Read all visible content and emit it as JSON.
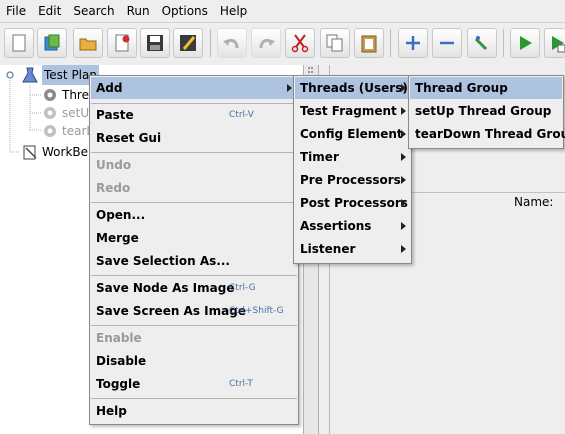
{
  "menubar": {
    "items": [
      "File",
      "Edit",
      "Search",
      "Run",
      "Options",
      "Help"
    ]
  },
  "toolbar": {
    "buttons": [
      "new-icon",
      "templates-icon",
      "open-icon",
      "close-icon",
      "save-icon",
      "save-as-icon",
      "undo-icon",
      "redo-icon",
      "cut-icon",
      "copy-icon",
      "paste-icon",
      "expand-icon",
      "collapse-icon",
      "toggle-icon",
      "start-icon",
      "start-no-timers-icon"
    ]
  },
  "tree": {
    "nodes": [
      {
        "label": "Test Plan",
        "icon": "test-plan-icon"
      },
      {
        "label": "Thread Group",
        "icon": "thread-group-icon"
      },
      {
        "label": "setUp Thread Group",
        "icon": "setup-thread-group-icon"
      },
      {
        "label": "tearDown Thread Group",
        "icon": "teardown-thread-group-icon"
      },
      {
        "label": "WorkBench",
        "icon": "workbench-icon"
      }
    ]
  },
  "right_panel": {
    "name_label": "Name:"
  },
  "context_menu": {
    "items": [
      {
        "label": "Add",
        "submenu": true
      },
      {
        "label": "Paste",
        "shortcut": "Ctrl-V"
      },
      {
        "label": "Reset Gui"
      },
      {
        "label": "Undo",
        "disabled": true
      },
      {
        "label": "Redo",
        "disabled": true
      },
      {
        "label": "Open..."
      },
      {
        "label": "Merge"
      },
      {
        "label": "Save Selection As..."
      },
      {
        "label": "Save Node As Image",
        "shortcut": "Ctrl-G"
      },
      {
        "label": "Save Screen As Image",
        "shortcut": "Ctrl+Shift-G"
      },
      {
        "label": "Enable",
        "disabled": true
      },
      {
        "label": "Disable"
      },
      {
        "label": "Toggle",
        "shortcut": "Ctrl-T"
      },
      {
        "label": "Help"
      }
    ]
  },
  "add_submenu": {
    "items": [
      "Threads (Users)",
      "Test Fragment",
      "Config Element",
      "Timer",
      "Pre Processors",
      "Post Processors",
      "Assertions",
      "Listener"
    ]
  },
  "threads_submenu": {
    "items": [
      "Thread Group",
      "setUp Thread Group",
      "tearDown Thread Group"
    ]
  },
  "colors": {
    "selection": "#aec3e0",
    "menu_bg": "#eeeeee",
    "shortcut": "#4a6ea0"
  }
}
